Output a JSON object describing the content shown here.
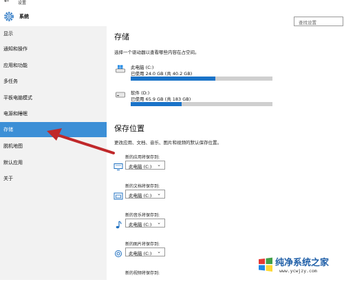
{
  "window": {
    "back_icon": "back-arrow-icon",
    "title": "设置"
  },
  "header": {
    "app_icon": "gear-icon",
    "app_name": "系统",
    "search_placeholder": "查找设置"
  },
  "sidebar": {
    "items": [
      {
        "label": "显示"
      },
      {
        "label": "通知和操作"
      },
      {
        "label": "应用和功能"
      },
      {
        "label": "多任务"
      },
      {
        "label": "平板电脑模式"
      },
      {
        "label": "电源和睡眠"
      },
      {
        "label": "存储",
        "active": true
      },
      {
        "label": "脱机地图"
      },
      {
        "label": "默认应用"
      },
      {
        "label": "关于"
      }
    ],
    "active_color": "#3c8fd6"
  },
  "storage": {
    "title": "存储",
    "description": "选择一个驱动器以查看哪些内容在占空间。",
    "drives": [
      {
        "name": "此电脑 (C:)",
        "usage": "已使用 24.0 GB (共 40.2 GB)",
        "used_fraction": 0.597,
        "icon": "windows-drive-icon"
      },
      {
        "name": "软件 (D:)",
        "usage": "已使用 65.9 GB (共 183 GB)",
        "used_fraction": 0.36,
        "icon": "hard-drive-icon"
      }
    ],
    "bar_color": "#1a73c8"
  },
  "save_locations": {
    "title": "保存位置",
    "description": "更改应用、文档、音乐、图片和视频的默认保存位置。",
    "items": [
      {
        "label": "新的应用将保存到:",
        "value": "此电脑 (C:)",
        "icon": "monitor-icon"
      },
      {
        "label": "新的文档将保存到:",
        "value": "此电脑 (C:)",
        "icon": "document-folder-icon"
      },
      {
        "label": "新的音乐将保存到:",
        "value": "此电脑 (C:)",
        "icon": "music-note-icon"
      },
      {
        "label": "新的图片将保存到:",
        "value": "此电脑 (C:)",
        "icon": "camera-icon"
      },
      {
        "label": "新的视频将保存到:",
        "value": "",
        "icon": "video-icon"
      }
    ]
  },
  "annotation": {
    "arrow_color": "#c0282a"
  },
  "watermark": {
    "text": "纯净系统之家",
    "url": "www.ycwjzy.com"
  }
}
